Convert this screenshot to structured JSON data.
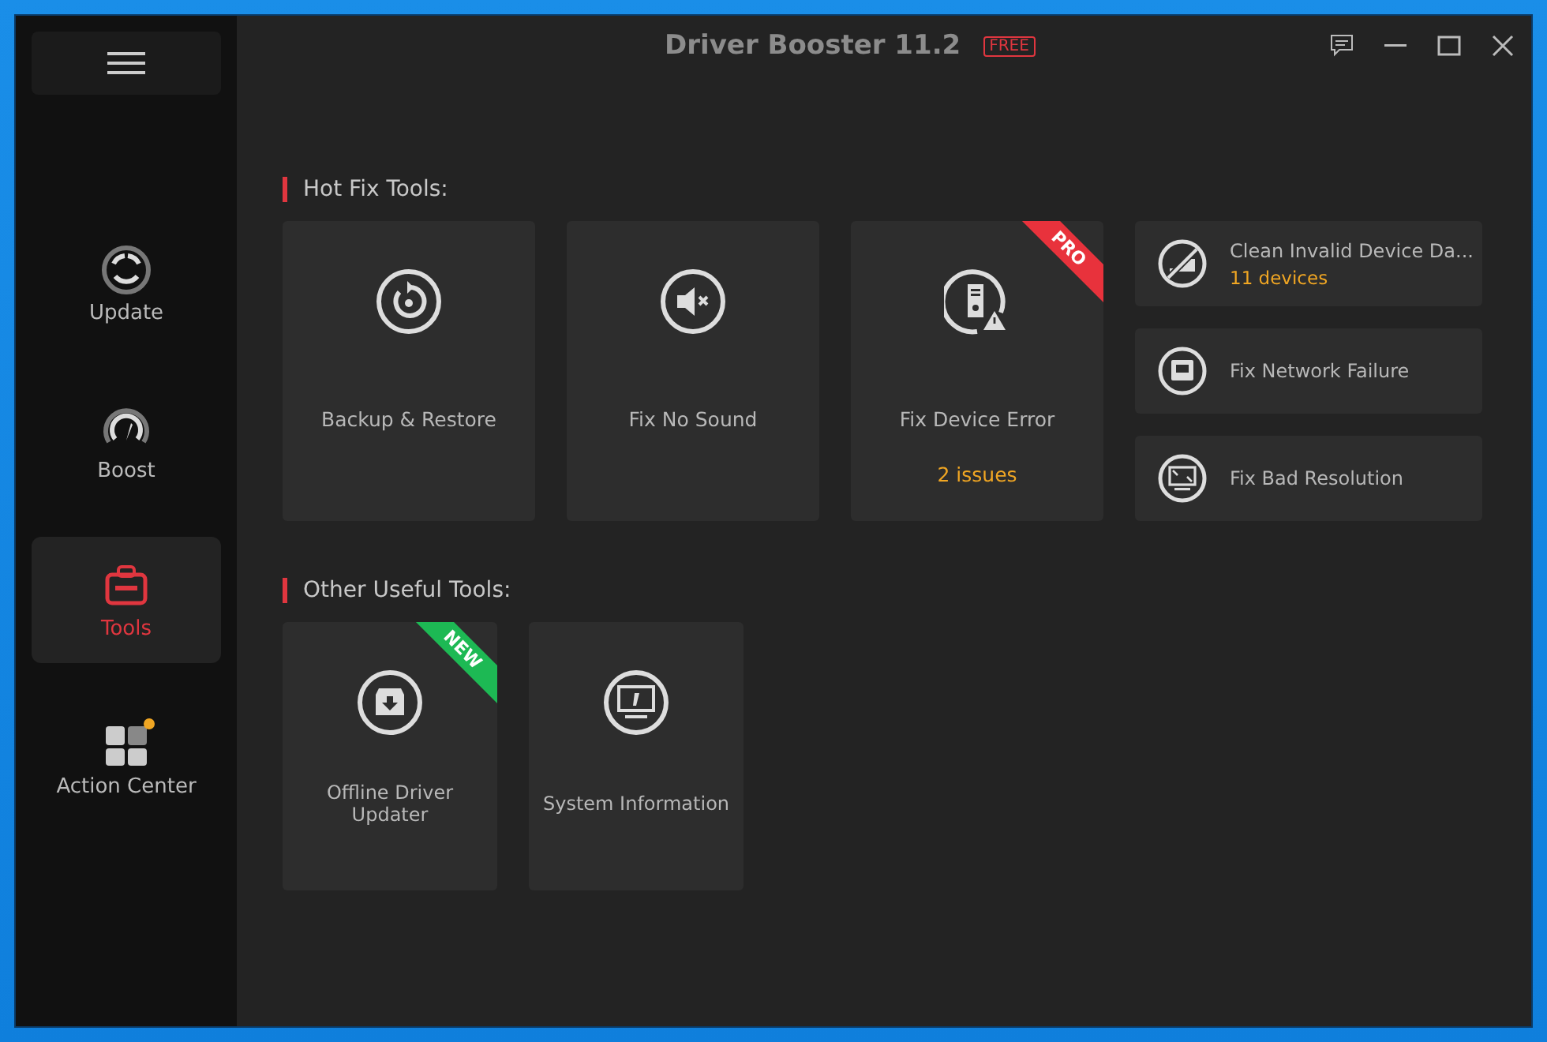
{
  "window": {
    "title": "Driver Booster 11.2",
    "edition_badge": "FREE"
  },
  "sidebar": {
    "items": [
      {
        "label": "Update",
        "selected": false,
        "notification": false
      },
      {
        "label": "Boost",
        "selected": false,
        "notification": false
      },
      {
        "label": "Tools",
        "selected": true,
        "notification": false
      },
      {
        "label": "Action Center",
        "selected": false,
        "notification": true
      }
    ]
  },
  "hot_fix_tools": {
    "heading": "Hot Fix Tools:",
    "cards": [
      {
        "label": "Backup & Restore"
      },
      {
        "label": "Fix No Sound"
      },
      {
        "label": "Fix Device Error",
        "status": "2 issues",
        "ribbon": {
          "text": "PRO",
          "kind": "pro"
        }
      }
    ],
    "list": [
      {
        "label": "Clean Invalid Device Da...",
        "status": "11 devices"
      },
      {
        "label": "Fix Network Failure"
      },
      {
        "label": "Fix Bad Resolution"
      }
    ]
  },
  "other_useful_tools": {
    "heading": "Other Useful Tools:",
    "cards": [
      {
        "label": "Offline Driver Updater",
        "ribbon": {
          "text": "NEW",
          "kind": "new"
        }
      },
      {
        "label": "System Information"
      }
    ]
  }
}
